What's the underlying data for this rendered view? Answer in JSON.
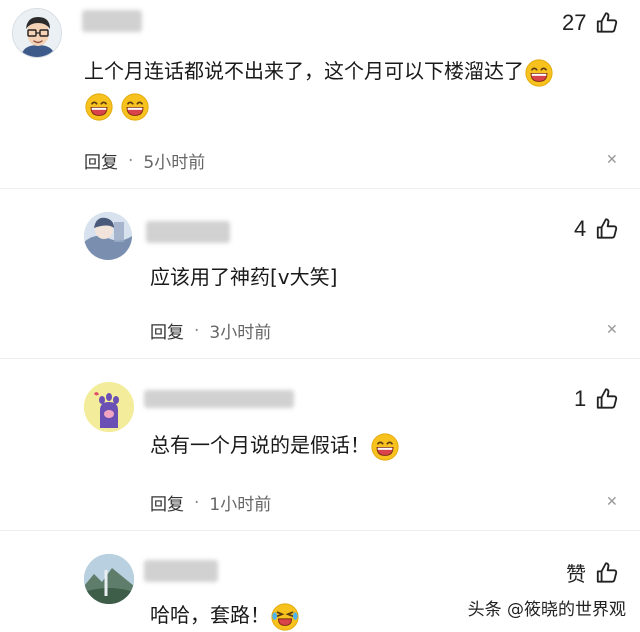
{
  "comments": [
    {
      "likes": "27",
      "text_line1": "上个月连话都说不出来了，这个月可以下楼溜达了",
      "reply_label": "回复",
      "separator": "·",
      "time": "5小时前",
      "close": "✕"
    },
    {
      "likes": "4",
      "text": "应该用了神药[v大笑]",
      "reply_label": "回复",
      "separator": "·",
      "time": "3小时前",
      "close": "✕"
    },
    {
      "likes": "1",
      "text": "总有一个月说的是假话！",
      "reply_label": "回复",
      "separator": "·",
      "time": "1小时前",
      "close": "✕"
    },
    {
      "likes": "赞",
      "text": "哈哈，套路！"
    }
  ],
  "watermark": "头条 @筱晓的世界观",
  "colors": {
    "emoji_face": "#f7c21e",
    "emoji_mouth": "#d9434b",
    "avatar_purple": "#6a4fb5"
  }
}
